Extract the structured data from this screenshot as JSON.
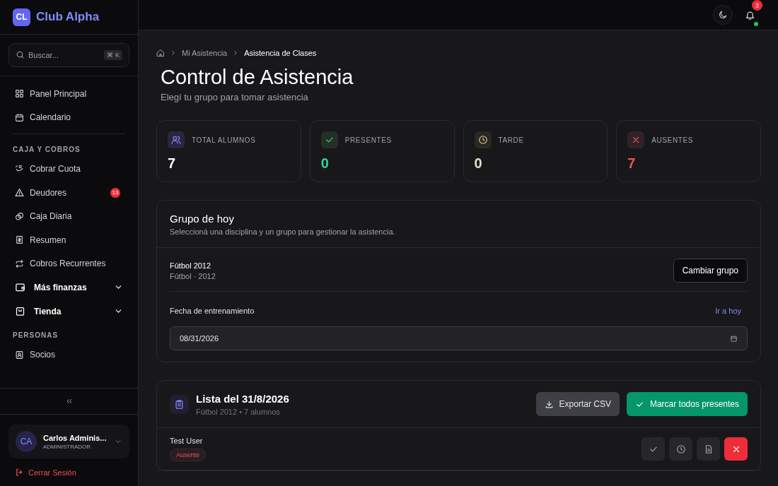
{
  "brand": {
    "logo": "CL",
    "name": "Club Alpha"
  },
  "search": {
    "placeholder": "Buscar...",
    "shortcut": "⌘ K"
  },
  "sidebar": {
    "sections": [
      {
        "items": [
          {
            "kind": "link",
            "label": "Panel Principal"
          },
          {
            "kind": "link",
            "label": "Calendario"
          }
        ]
      },
      {
        "title": "CAJA Y COBROS",
        "items": [
          {
            "kind": "link",
            "label": "Cobrar Cuota"
          },
          {
            "kind": "link",
            "label": "Deudores",
            "badge": "13"
          },
          {
            "kind": "link",
            "label": "Caja Diaria"
          },
          {
            "kind": "link",
            "label": "Resumen"
          },
          {
            "kind": "link",
            "label": "Cobros Recurrentes"
          },
          {
            "kind": "group",
            "label": "Más finanzas",
            "expanded": false
          },
          {
            "kind": "group",
            "label": "Tienda",
            "expanded": false
          }
        ]
      },
      {
        "title": "PERSONAS",
        "items": [
          {
            "kind": "link",
            "label": "Socios"
          }
        ]
      }
    ]
  },
  "user": {
    "initials": "CA",
    "name": "Carlos Adminis...",
    "role": "ADMINISTRADOR"
  },
  "logout": "Cerrar Sesión",
  "header": {
    "notifications": "3"
  },
  "breadcrumb": [
    "Mi Asistencia",
    "Asistencia de Clases"
  ],
  "title": "Control de Asistencia",
  "subtitle": "Elegí tu grupo para tomar asistencia",
  "stats": [
    {
      "label": "TOTAL ALUMNOS",
      "value": "7",
      "color": "#ffffff"
    },
    {
      "label": "PRESENTES",
      "value": "0",
      "color": "#34d399"
    },
    {
      "label": "TARDE",
      "value": "0",
      "color": "#d9e6c3"
    },
    {
      "label": "AUSENTES",
      "value": "7",
      "color": "#f05252"
    }
  ],
  "group_card": {
    "title": "Grupo de hoy",
    "subtitle": "Seleccioná una disciplina y un grupo para gestionar la asistencia.",
    "group_name": "Fútbol 2012",
    "group_detail": "Fútbol · 2012",
    "change_button": "Cambiar grupo",
    "date_label": "Fecha de entrenamiento",
    "today_link": "Ir a hoy",
    "date_value": "08/31/2026"
  },
  "list": {
    "title": "Lista del 31/8/2026",
    "subtitle": "Fútbol 2012 • 7 alumnos",
    "export_button": "Exportar CSV",
    "mark_all_button": "Marcar todos presentes",
    "rows": [
      {
        "name": "Test User",
        "status": {
          "label": "Ausente",
          "kind": "absent"
        }
      }
    ]
  }
}
